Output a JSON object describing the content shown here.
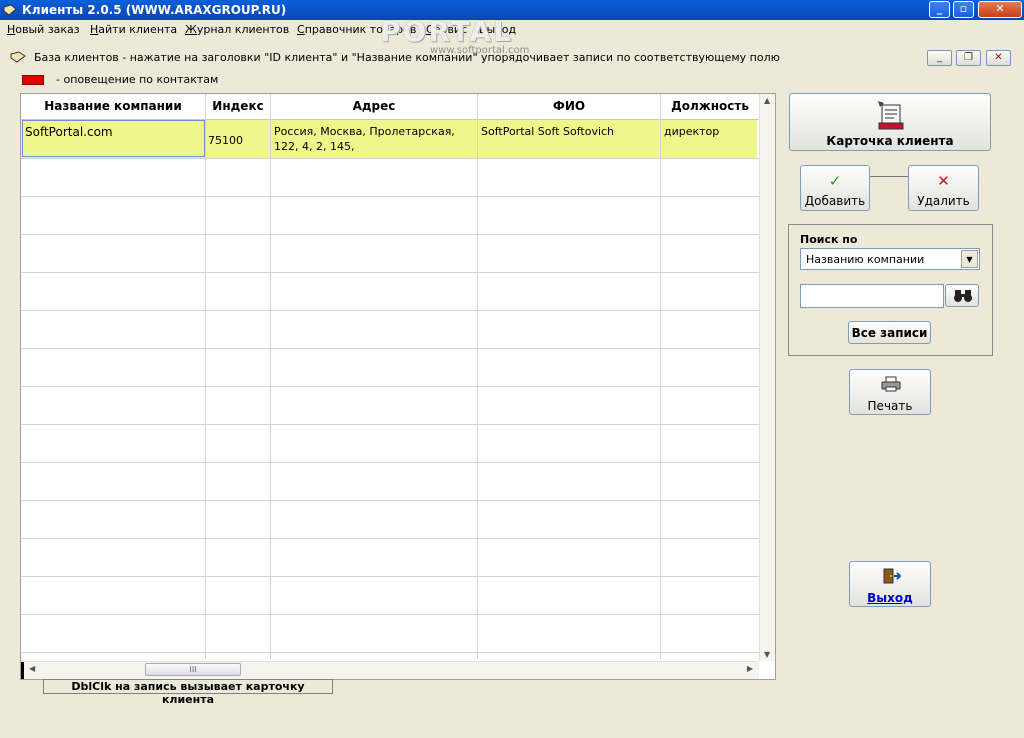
{
  "window": {
    "title": "Клиенты 2.0.5 (WWW.ARAXGROUP.RU)"
  },
  "menu": {
    "items": [
      "Новый заказ",
      "Найти клиента",
      "Журнал клиентов",
      "Справочник товаров",
      "Сервис",
      "Выход"
    ]
  },
  "watermark": {
    "logo": "PORTAL",
    "site": "www.softportal.com"
  },
  "child": {
    "title": "База клиентов - нажатие на заголовки \"ID клиента\" и \"Название компании\" упорядочивает записи по соответствующему полю"
  },
  "legend": {
    "swatch_color": "#e00000",
    "text": "- оповещение по контактам"
  },
  "grid": {
    "columns": [
      "Название компании",
      "Индекс",
      "Адрес",
      "ФИО",
      "Должность"
    ],
    "rows": [
      {
        "company": "SoftPortal.com",
        "index": "75100",
        "address_line1": "Россия, Москва, Пролетарская,",
        "address_line2": "122, 4, 2, 145,",
        "fio": "SoftPortal Soft Softovich",
        "position": "директор"
      }
    ],
    "scrollbar_thumb": "III"
  },
  "hint": "DblClk на запись вызывает карточку клиента",
  "buttons": {
    "card": "Карточка клиента",
    "add": "Добавить",
    "delete": "Удалить",
    "show_all": "Все записи",
    "print": "Печать",
    "exit": "Выход"
  },
  "search": {
    "label": "Поиск по",
    "selected": "Названию компании",
    "value": ""
  }
}
